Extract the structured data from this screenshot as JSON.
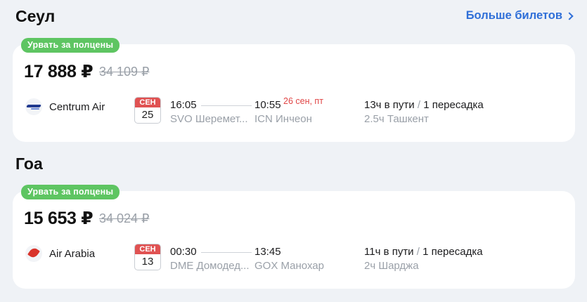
{
  "sections": [
    {
      "city": "Сеул",
      "more_link": "Больше билетов",
      "ticket": {
        "badge": "Урвать за полцены",
        "price": "17 888 ₽",
        "old_price": "34 109 ₽",
        "airline": "Centrum Air",
        "airline_icon": "centrum-air-logo-icon",
        "date_month": "СЕН",
        "date_day": "25",
        "dep_time": "16:05",
        "dep_airport": "SVO Шеремет...",
        "arr_time": "10:55",
        "arr_date": "26 сен, пт",
        "arr_airport": "ICN Инчеон",
        "duration": "13ч в пути",
        "stops": "1 пересадка",
        "layover": "2.5ч Ташкент"
      }
    },
    {
      "city": "Гоа",
      "ticket": {
        "badge": "Урвать за полцены",
        "price": "15 653 ₽",
        "old_price": "34 024 ₽",
        "airline": "Air Arabia",
        "airline_icon": "air-arabia-logo-icon",
        "date_month": "СЕН",
        "date_day": "13",
        "dep_time": "00:30",
        "dep_airport": "DME Домодед...",
        "arr_time": "13:45",
        "arr_airport": "GOX Манохар",
        "duration": "11ч в пути",
        "stops": "1 пересадка",
        "layover": "2ч Шарджа"
      }
    }
  ],
  "colors": {
    "badge": "#5ec562",
    "link": "#2f6fd8",
    "calendar_header": "#e05252",
    "next_day_date": "#e04545"
  }
}
